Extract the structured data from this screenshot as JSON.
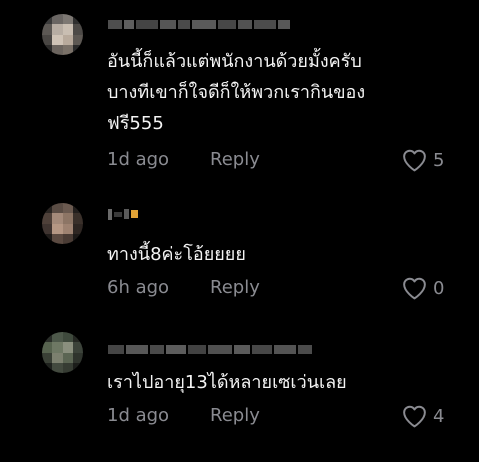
{
  "comments": [
    {
      "text_lines": [
        "อันนี้ก็แล้วแต่พนักงานด้วยมั้งครับ",
        "บางทีเขาก็ใจดีก็ให้พวกเรากินของ",
        "ฟรี555"
      ],
      "time": "1d ago",
      "reply_label": "Reply",
      "likes": "5"
    },
    {
      "text_lines": [
        "ทางนี้8ค่ะโอ้ยยยย"
      ],
      "time": "6h ago",
      "reply_label": "Reply",
      "likes": "0"
    },
    {
      "text_lines": [
        "เราไปอายุ13ได้หลายเซเว่นเลย"
      ],
      "time": "1d ago",
      "reply_label": "Reply",
      "likes": "4"
    }
  ],
  "icons": {
    "like": "heart-outline-icon"
  },
  "colors": {
    "background": "#000000",
    "text": "#f4f4f4",
    "secondary": "#8a8b91"
  }
}
